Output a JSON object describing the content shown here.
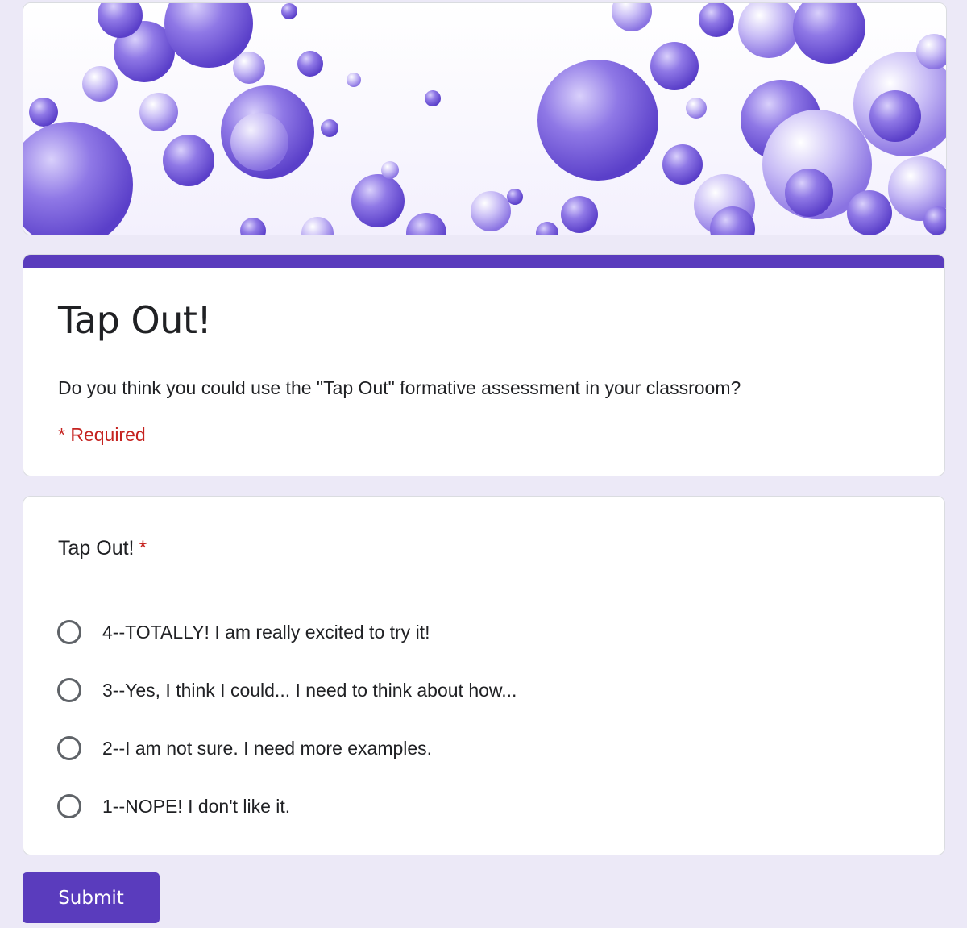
{
  "theme": {
    "accent": "#5a3cbd",
    "background": "#ece9f7",
    "required_color": "#c5221f",
    "bubble_color": "#7b63de"
  },
  "header": {
    "image": "purple-bubbles-banner"
  },
  "form": {
    "title": "Tap Out!",
    "description": "Do you think you could use the \"Tap Out\" formative assessment in your classroom?",
    "required_note": "* Required"
  },
  "question": {
    "title": "Tap Out!",
    "required_marker": "*",
    "options": [
      {
        "label": "4--TOTALLY! I am really excited to try it!"
      },
      {
        "label": "3--Yes, I think I could... I need to think about how..."
      },
      {
        "label": "2--I am not sure. I need more examples."
      },
      {
        "label": "1--NOPE! I don't like it."
      }
    ]
  },
  "actions": {
    "submit_label": "Submit"
  }
}
